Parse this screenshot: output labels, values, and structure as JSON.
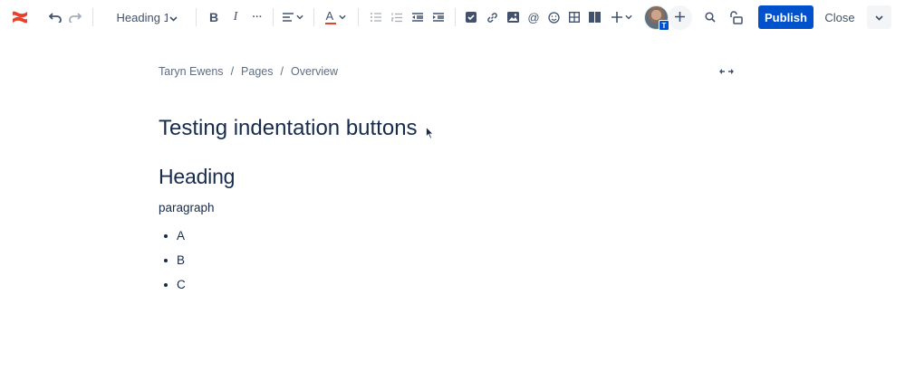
{
  "toolbar": {
    "heading_style": "Heading 1",
    "bold": "B",
    "italic": "I",
    "more_formatting": "···",
    "text_color": "A",
    "avatar_badge": "T",
    "publish_label": "Publish",
    "close_label": "Close"
  },
  "breadcrumb": {
    "items": [
      "Taryn Ewens",
      "Pages",
      "Overview"
    ],
    "separator": "/"
  },
  "content": {
    "title": "Testing indentation buttons",
    "heading": "Heading",
    "paragraph": "paragraph",
    "list_items": [
      "A",
      "B",
      "C"
    ]
  },
  "colors": {
    "accent": "#0052cc",
    "logo": "#e8412a",
    "text": "#172b4d",
    "muted": "#5e6c84"
  }
}
